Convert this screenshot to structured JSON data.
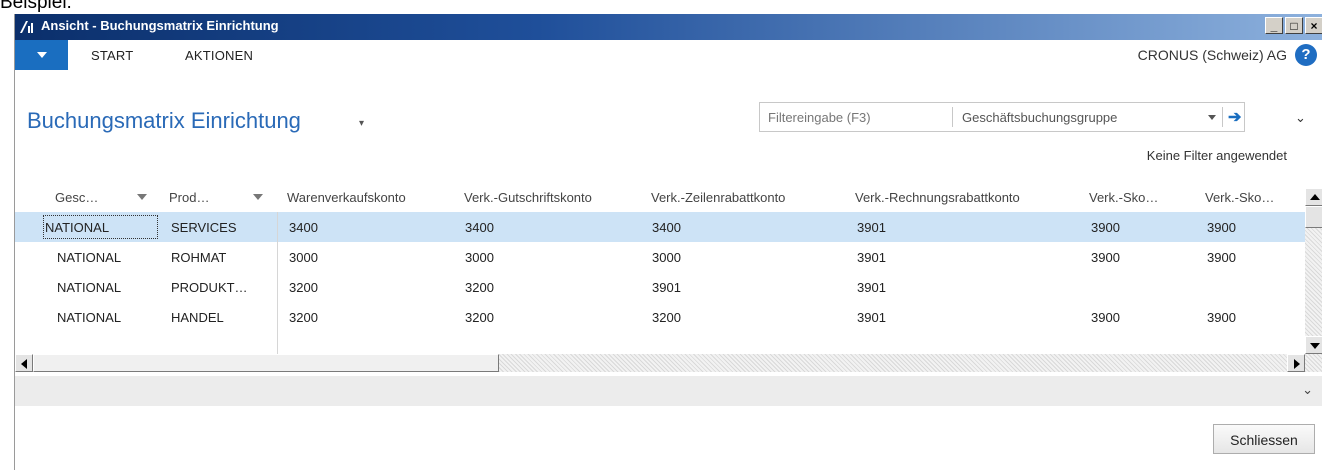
{
  "caption": "Beispiel:",
  "window": {
    "title": "Ansicht - Buchungsmatrix Einrichtung",
    "controls": {
      "minimize": "_",
      "maximize": "□",
      "close": "×"
    }
  },
  "ribbon": {
    "tabs": [
      "START",
      "AKTIONEN"
    ],
    "company": "CRONUS (Schweiz) AG",
    "help_icon": "?"
  },
  "page": {
    "title": "Buchungsmatrix Einrichtung",
    "title_chevron": "▾",
    "collapse_chevron": "⌄"
  },
  "filter": {
    "placeholder": "Filtereingabe (F3)",
    "field": "Geschäftsbuchungsgruppe",
    "go_icon": "➔",
    "status": "Keine Filter angewendet"
  },
  "table": {
    "columns": [
      "Gesc…",
      "Prod…",
      "Warenverkaufskonto",
      "Verk.-Gutschriftskonto",
      "Verk.-Zeilenrabattkonto",
      "Verk.-Rechnungsrabattkonto",
      "Verk.-Sko…",
      "Verk.-Sko…"
    ],
    "rows": [
      [
        "NATIONAL",
        "SERVICES",
        "3400",
        "3400",
        "3400",
        "3901",
        "3900",
        "3900"
      ],
      [
        "NATIONAL",
        "ROHMAT",
        "3000",
        "3000",
        "3000",
        "3901",
        "3900",
        "3900"
      ],
      [
        "NATIONAL",
        "PRODUKT…",
        "3200",
        "3200",
        "3901",
        "3901",
        "",
        ""
      ],
      [
        "NATIONAL",
        "HANDEL",
        "3200",
        "3200",
        "3200",
        "3901",
        "3900",
        "3900"
      ]
    ],
    "selected_row": 0
  },
  "factbox_chevron": "⌄",
  "buttons": {
    "close": "Schliessen"
  },
  "colors": {
    "accent": "#1a6ec0",
    "title_blue": "#2a6ab7",
    "selected_row": "#cde3f6"
  }
}
